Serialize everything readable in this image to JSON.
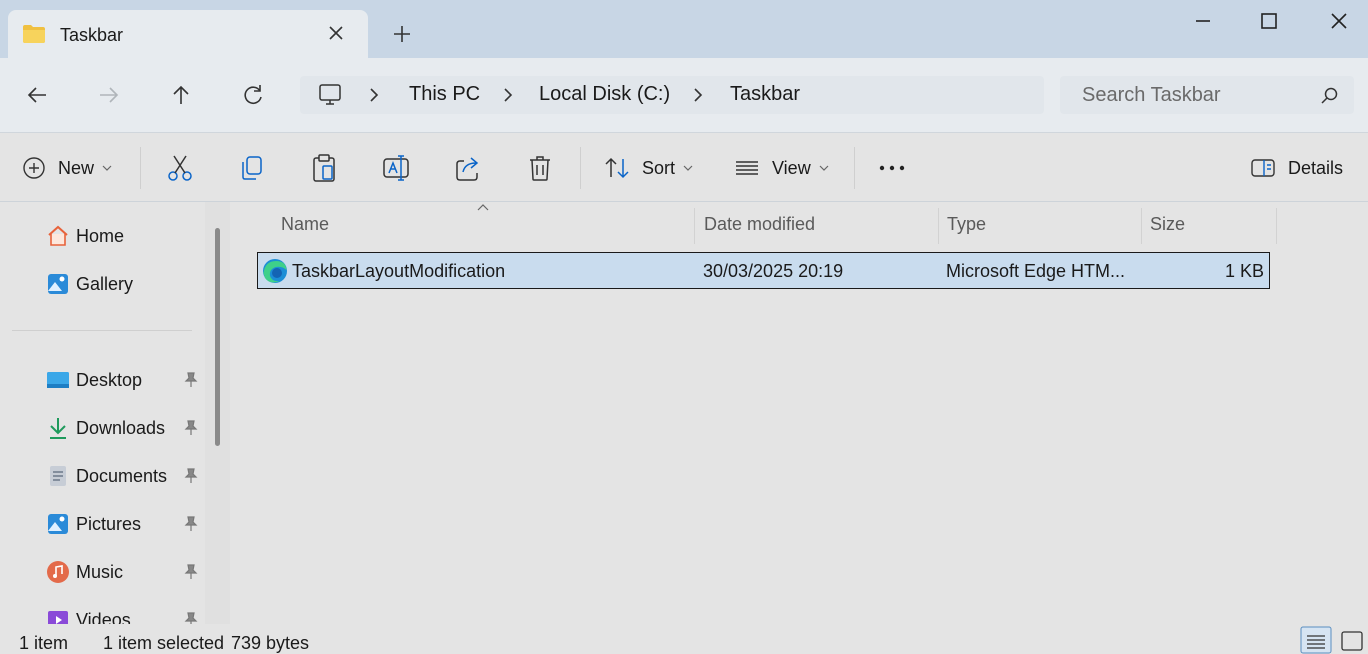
{
  "tab": {
    "title": "Taskbar"
  },
  "breadcrumb": {
    "items": [
      "This PC",
      "Local Disk (C:)",
      "Taskbar"
    ]
  },
  "search": {
    "placeholder": "Search Taskbar"
  },
  "commandbar": {
    "new_label": "New",
    "sort_label": "Sort",
    "view_label": "View",
    "details_label": "Details"
  },
  "sidebar": {
    "items": [
      {
        "label": "Home",
        "icon": "home-icon"
      },
      {
        "label": "Gallery",
        "icon": "gallery-icon"
      },
      {
        "label": "Desktop",
        "icon": "desktop-icon",
        "pinned": true
      },
      {
        "label": "Downloads",
        "icon": "downloads-icon",
        "pinned": true
      },
      {
        "label": "Documents",
        "icon": "documents-icon",
        "pinned": true
      },
      {
        "label": "Pictures",
        "icon": "pictures-icon",
        "pinned": true
      },
      {
        "label": "Music",
        "icon": "music-icon",
        "pinned": true
      },
      {
        "label": "Videos",
        "icon": "videos-icon",
        "pinned": true
      }
    ]
  },
  "filelist": {
    "columns": [
      "Name",
      "Date modified",
      "Type",
      "Size"
    ],
    "rows": [
      {
        "name": "TaskbarLayoutModification",
        "date": "30/03/2025 20:19",
        "type": "Microsoft Edge HTM...",
        "size": "1 KB",
        "selected": true
      }
    ]
  },
  "status": {
    "count": "1 item",
    "selected": "1 item selected",
    "size": "739 bytes"
  },
  "colors": {
    "selection": "#c9dcee",
    "titlebar": "#c8d6e5",
    "accent": "#0a64c8"
  }
}
